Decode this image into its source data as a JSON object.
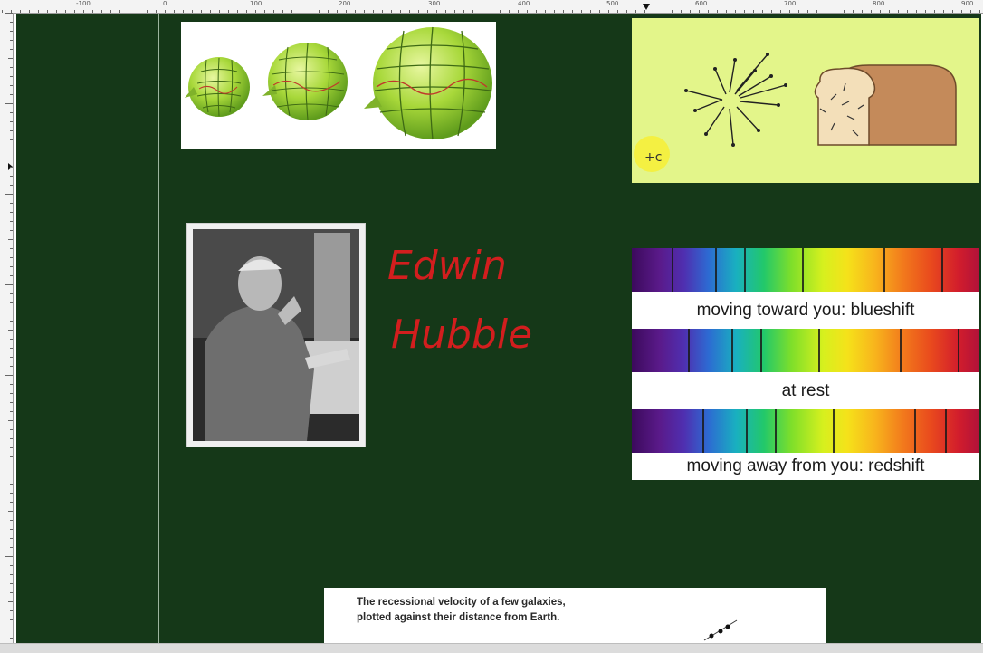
{
  "ruler": {
    "top_labels": [
      "-100",
      "0",
      "100",
      "200",
      "300",
      "400",
      "500",
      "600",
      "700",
      "800",
      "900"
    ]
  },
  "colors": {
    "board": "#153818",
    "bread_panel": "#e3f58a",
    "handwriting": "#d21e1e"
  },
  "handwriting": {
    "line1": "Edwin",
    "line2": "Hubble"
  },
  "bread_panel": {
    "label": "+c"
  },
  "spectra": [
    {
      "label": "moving toward you: blueshift"
    },
    {
      "label": "at rest"
    },
    {
      "label": "moving away from you: redshift"
    }
  ],
  "graph_card": {
    "caption_line1": "The recessional velocity of a few galaxies,",
    "caption_line2": "plotted against their distance from Earth."
  }
}
